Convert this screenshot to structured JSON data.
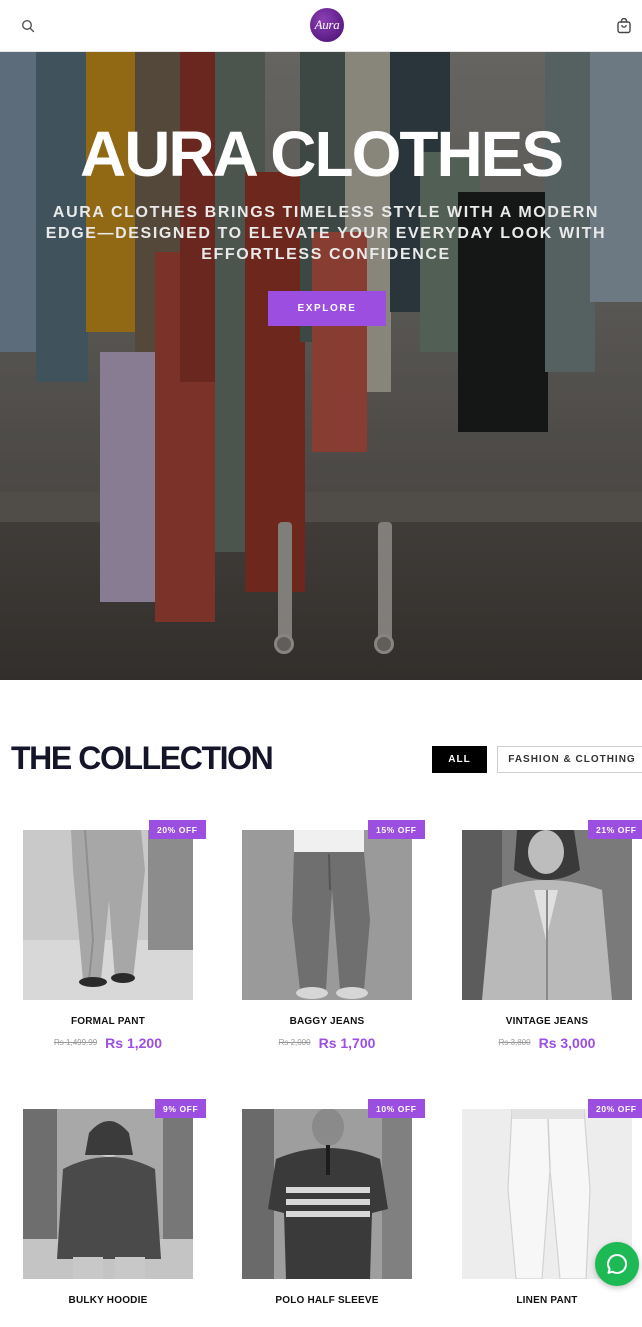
{
  "header": {
    "logo_text": "Aura",
    "search_icon": "search-icon",
    "cart_icon": "shopping-bag-icon"
  },
  "hero": {
    "title": "AURA CLOTHES",
    "subtitle": "AURA CLOTHES BRINGS TIMELESS STYLE WITH A MODERN EDGE—DESIGNED TO ELEVATE YOUR EVERYDAY LOOK WITH EFFORTLESS CONFIDENCE",
    "cta": "EXPLORE"
  },
  "collection": {
    "title": "THE COLLECTION",
    "filters": [
      "ALL",
      "FASHION & CLOTHING"
    ],
    "active_filter": "ALL",
    "products": [
      {
        "name": "FORMAL PANT",
        "badge": "20% OFF",
        "old_price": "Rs 1,499.99",
        "price": "Rs 1,200"
      },
      {
        "name": "BAGGY JEANS",
        "badge": "15% OFF",
        "old_price": "Rs 2,000",
        "price": "Rs 1,700"
      },
      {
        "name": "VINTAGE JEANS",
        "badge": "21% OFF",
        "old_price": "Rs 3,800",
        "price": "Rs 3,000"
      },
      {
        "name": "BULKY HOODIE",
        "badge": "9% OFF",
        "old_price": "",
        "price": ""
      },
      {
        "name": "POLO HALF SLEEVE",
        "badge": "10% OFF",
        "old_price": "",
        "price": ""
      },
      {
        "name": "LINEN PANT",
        "badge": "20% OFF",
        "old_price": "",
        "price": ""
      }
    ]
  },
  "colors": {
    "accent": "#9b4ee0",
    "title": "#15152a",
    "chat": "#1db954"
  },
  "chat": {
    "icon": "whatsapp-chat-icon"
  }
}
